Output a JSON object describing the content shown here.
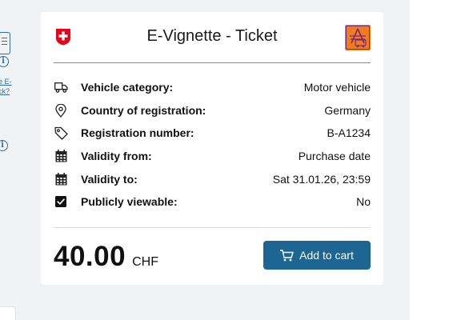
{
  "left_column": {
    "link_text": "e E-\nck?"
  },
  "card": {
    "title": "E-Vignette - Ticket",
    "rows": [
      {
        "icon": "truck-icon",
        "label": "Vehicle category:",
        "value": "Motor vehicle"
      },
      {
        "icon": "location-pin-icon",
        "label": "Country of registration:",
        "value": "Germany"
      },
      {
        "icon": "tag-icon",
        "label": "Registration number:",
        "value": "B-A1234"
      },
      {
        "icon": "calendar-icon",
        "label": "Validity from:",
        "value": "Purchase date"
      },
      {
        "icon": "calendar-icon",
        "label": "Validity to:",
        "value": "Sat 31.01.26, 23:59"
      },
      {
        "icon": "checkbox-checked-icon",
        "label": "Publicly viewable:",
        "value": "No"
      }
    ],
    "price": {
      "amount": "40.00",
      "currency": "CHF"
    },
    "add_to_cart_label": "Add to cart"
  },
  "colors": {
    "accent": "#1d6592",
    "swiss_red": "#e3051b",
    "badge_orange": "#f07d1a",
    "link_blue": "#2f6fa6"
  }
}
